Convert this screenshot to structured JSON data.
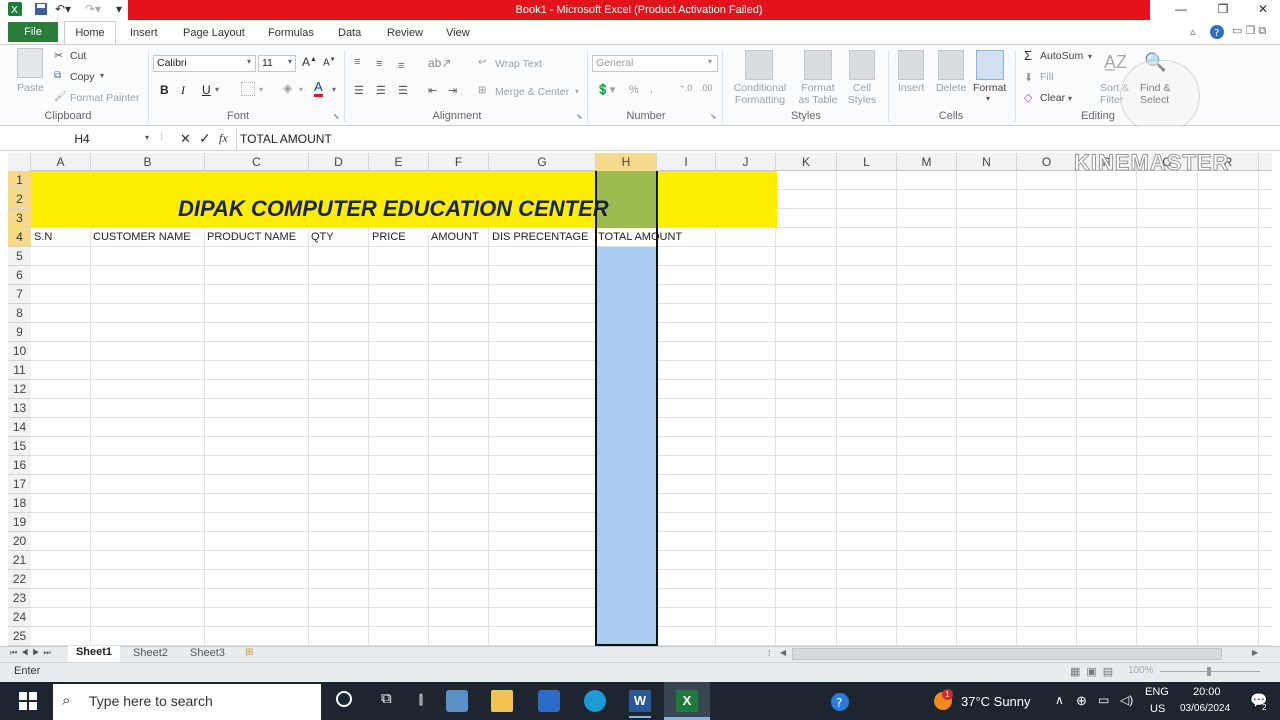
{
  "title": "Book1  -  Microsoft Excel (Product Activation Failed)",
  "tabs": [
    "File",
    "Home",
    "Insert",
    "Page Layout",
    "Formulas",
    "Data",
    "Review",
    "View"
  ],
  "clipboard": {
    "paste": "Paste",
    "cut": "Cut",
    "copy": "Copy",
    "format_painter": "Format Painter",
    "label": "Clipboard"
  },
  "font": {
    "name": "Calibri",
    "size": "11",
    "label": "Font",
    "bold": "B",
    "italic": "I",
    "underline": "U"
  },
  "alignment": {
    "wrap": "Wrap Text",
    "merge": "Merge & Center",
    "label": "Alignment"
  },
  "number": {
    "format": "General",
    "label": "Number",
    "percent": "%"
  },
  "styles": {
    "conditional": [
      "Conditional",
      "Formatting"
    ],
    "table": [
      "Format",
      "as Table"
    ],
    "cell": [
      "Cell",
      "Styles"
    ],
    "label": "Styles"
  },
  "cells": {
    "insert": "Insert",
    "delete": "Delete",
    "format": "Format",
    "label": "Cells"
  },
  "editing": {
    "autosum": "AutoSum",
    "fill": "Fill",
    "clear": "Clear",
    "sort": [
      "Sort &",
      "Filter"
    ],
    "find": [
      "Find &",
      "Select"
    ],
    "label": "Editing"
  },
  "formula_bar": {
    "name_box": "H4",
    "fx": "fx",
    "content": "TOTAL AMOUNT"
  },
  "columns": [
    "A",
    "B",
    "C",
    "D",
    "E",
    "F",
    "G",
    "H",
    "I",
    "J",
    "K",
    "L",
    "M",
    "N",
    "O",
    "P",
    "Q",
    "R"
  ],
  "rows": [
    "1",
    "2",
    "3",
    "4",
    "5",
    "6",
    "7",
    "8",
    "9",
    "10",
    "11",
    "12",
    "13",
    "14",
    "15",
    "16",
    "17",
    "18",
    "19",
    "20",
    "21",
    "22",
    "23",
    "24",
    "25"
  ],
  "sheet": {
    "banner": "DIPAK COMPUTER EDUCATION CENTER",
    "headers": [
      "S.N",
      "CUSTOMER NAME",
      "PRODUCT NAME",
      "QTY",
      "PRICE",
      "AMOUNT",
      "DIS PRECENTAGE",
      "TOTAL AMOUNT"
    ],
    "banner_color": "#ffee00",
    "selected_fill": "#9dbb4f",
    "column_fill": "#a9cdf1"
  },
  "watermark": "KINEMASTER",
  "sheet_tabs": [
    "Sheet1",
    "Sheet2",
    "Sheet3"
  ],
  "status": {
    "mode": "Enter",
    "zoom": "100%"
  },
  "taskbar": {
    "search_placeholder": "Type here to search",
    "weather": "37°C  Sunny",
    "lang": [
      "ENG",
      "US"
    ],
    "time": "20:00",
    "date": "03/06/2024",
    "badge": "1",
    "notif": "2"
  }
}
